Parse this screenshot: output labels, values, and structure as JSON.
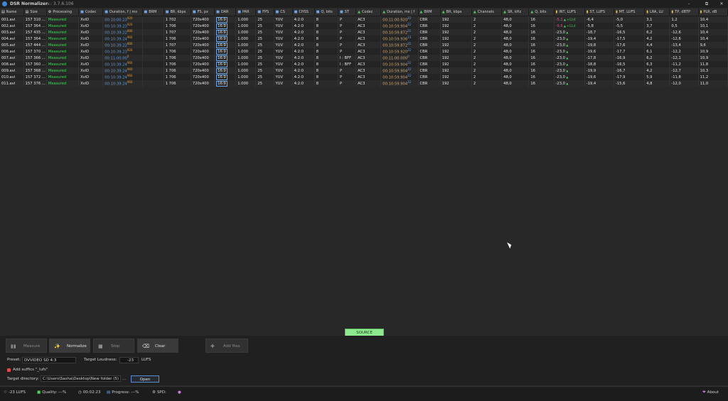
{
  "window": {
    "title": "DSR Normalizer",
    "version": "v.: 3.7.6.106",
    "controls": [
      "–",
      "⧉",
      "✕"
    ]
  },
  "colors": {
    "background": "#282828",
    "measured": "#33e04a",
    "duration_blue": "#5d9ae0",
    "duration_tan": "#c9a97a",
    "source_button": "#8ee88e",
    "int_red": "#e04a8a"
  },
  "table": {
    "columns": [
      {
        "label": "Name",
        "icon": "file-icon"
      },
      {
        "label": "Size",
        "icon": "file-icon"
      },
      {
        "label": "Processing",
        "icon": "gear-icon"
      },
      {
        "label": "Codec",
        "icon": "video-icon"
      },
      {
        "label": "Duration, f | ms",
        "icon": "video-icon"
      },
      {
        "label": "BRM",
        "icon": "video-icon"
      },
      {
        "label": "BR, kbps",
        "icon": "video-icon"
      },
      {
        "label": "FS, px",
        "icon": "video-icon"
      },
      {
        "label": "DAR",
        "icon": "video-icon"
      },
      {
        "label": "PAR",
        "icon": "video-icon"
      },
      {
        "label": "FPS",
        "icon": "video-icon"
      },
      {
        "label": "CS",
        "icon": "video-icon"
      },
      {
        "label": "CHSS",
        "icon": "video-icon"
      },
      {
        "label": "Q, bits",
        "icon": "video-icon"
      },
      {
        "label": "ST",
        "icon": "video-icon"
      },
      {
        "label": "Codec",
        "icon": "audio-icon"
      },
      {
        "label": "Duration, ms | f",
        "icon": "audio-icon"
      },
      {
        "label": "BRM",
        "icon": "audio-icon"
      },
      {
        "label": "BR, kbps",
        "icon": "audio-icon"
      },
      {
        "label": "Channels",
        "icon": "audio-icon"
      },
      {
        "label": "SR, kHz",
        "icon": "audio-icon"
      },
      {
        "label": "Q, bits",
        "icon": "audio-icon"
      },
      {
        "label": "INT, LUFS",
        "icon": "loudness-icon"
      },
      {
        "label": "ST, LUFS",
        "icon": "loudness-icon"
      },
      {
        "label": "MT, LUFS",
        "icon": "loudness-icon"
      },
      {
        "label": "LRA, LU",
        "icon": "loudness-icon"
      },
      {
        "label": "TP, dBTP",
        "icon": "loudness-icon"
      },
      {
        "label": "PLR, dB",
        "icon": "loudness-icon"
      }
    ],
    "rows": [
      {
        "name": "001.avi",
        "size": "157 310 ...",
        "processing": "Measured",
        "codec": "XviD",
        "vdur": "00:10:00.23",
        "vdur_sup": "920",
        "brm": "",
        "br": "1 702",
        "fs": "720x400",
        "dar": "16:9",
        "par": "1.000",
        "fps": "25",
        "cs": "YUV",
        "chss": "4:2:0",
        "q": "8",
        "st": "P",
        "acodec": "AC3",
        "adur": "00:11:00.920",
        "adur_sup": "22",
        "abrm": "CBR",
        "abr": "192",
        "channels": "2",
        "sr": "48,0",
        "aq": "16",
        "int": "-5,1",
        "int_sup": "+13,6",
        "int_red": true,
        "stl": "-6,4",
        "mtl": "-5,0",
        "lra": "3,1",
        "tp": "1,2",
        "plr": "10,4"
      },
      {
        "name": "002.avi",
        "size": "157 364 ...",
        "processing": "Measured",
        "codec": "XviD",
        "vdur": "00:10:39.23",
        "vdur_sup": "920",
        "brm": "",
        "br": "1 706",
        "fs": "720x400",
        "dar": "16:9",
        "par": "1.000",
        "fps": "25",
        "cs": "YUV",
        "chss": "4:2:0",
        "q": "8",
        "st": "P",
        "acodec": "AC3",
        "adur": "00:10:59.904",
        "adur_sup": "22",
        "abrm": "CBR",
        "abr": "192",
        "channels": "2",
        "sr": "48,0",
        "aq": "16",
        "int": "-9,6",
        "int_sup": "+13,4",
        "int_red": true,
        "stl": "-5,8",
        "mtl": "-5,5",
        "lra": "3,7",
        "tp": "0,5",
        "plr": "10,1"
      },
      {
        "name": "003.avi",
        "size": "157 435 ...",
        "processing": "Measured",
        "codec": "XviD",
        "vdur": "00:10:39.22",
        "vdur_sup": "880",
        "brm": "",
        "br": "1 707",
        "fs": "720x400",
        "dar": "16:9",
        "par": "1.000",
        "fps": "25",
        "cs": "YUV",
        "chss": "4:2:0",
        "q": "8",
        "st": "P",
        "acodec": "AC3",
        "adur": "00:10:59.872",
        "adur_sup": "21",
        "abrm": "CBR",
        "abr": "192",
        "channels": "2",
        "sr": "48,0",
        "aq": "16",
        "int": "-23,0",
        "int_sup": "",
        "int_red": false,
        "stl": "-18,7",
        "mtl": "-16,5",
        "lra": "6,2",
        "tp": "-12,6",
        "plr": "10,4"
      },
      {
        "name": "004.avi",
        "size": "157 364 ...",
        "processing": "Measured",
        "codec": "XviD",
        "vdur": "00:10:39.24",
        "vdur_sup": "960",
        "brm": "",
        "br": "1 706",
        "fs": "720x400",
        "dar": "16:9",
        "par": "1.000",
        "fps": "25",
        "cs": "YUV",
        "chss": "4:2:0",
        "q": "8",
        "st": "P",
        "acodec": "AC3",
        "adur": "00:10:59.936",
        "adur_sup": "23",
        "abrm": "CBR",
        "abr": "192",
        "channels": "2",
        "sr": "48,0",
        "aq": "16",
        "int": "-23,0",
        "int_sup": "",
        "int_red": false,
        "stl": "-19,4",
        "mtl": "-17,5",
        "lra": "4,2",
        "tp": "-12,6",
        "plr": "10,4"
      },
      {
        "name": "005.avi",
        "size": "157 444 ...",
        "processing": "Measured",
        "codec": "XviD",
        "vdur": "00:10:39.22",
        "vdur_sup": "880",
        "brm": "",
        "br": "1 707",
        "fs": "720x400",
        "dar": "16:9",
        "par": "1.000",
        "fps": "25",
        "cs": "YUV",
        "chss": "4:2:0",
        "q": "8",
        "st": "P",
        "acodec": "AC3",
        "adur": "00:10:59.872",
        "adur_sup": "21",
        "abrm": "CBR",
        "abr": "192",
        "channels": "2",
        "sr": "48,0",
        "aq": "16",
        "int": "-23,0",
        "int_sup": "",
        "int_red": false,
        "stl": "-19,8",
        "mtl": "-17,6",
        "lra": "4,4",
        "tp": "-13,4",
        "plr": "9,6"
      },
      {
        "name": "006.avi",
        "size": "157 370 ...",
        "processing": "Measured",
        "codec": "XviD",
        "vdur": "00:10:39.23",
        "vdur_sup": "920",
        "brm": "",
        "br": "1 706",
        "fs": "720x400",
        "dar": "16:9",
        "par": "1.000",
        "fps": "25",
        "cs": "YUV",
        "chss": "4:2:0",
        "q": "8",
        "st": "P",
        "acodec": "AC3",
        "adur": "00:10:59.920",
        "adur_sup": "22",
        "abrm": "CBR",
        "abr": "192",
        "channels": "2",
        "sr": "48,0",
        "aq": "16",
        "int": "-23,0",
        "int_sup": "",
        "int_red": false,
        "stl": "-19,6",
        "mtl": "-17,7",
        "lra": "6,1",
        "tp": "-12,2",
        "plr": "10,9"
      },
      {
        "name": "007.avi",
        "size": "157 366 ...",
        "processing": "Measured",
        "codec": "XviD",
        "vdur": "00:11:00.00",
        "vdur_sup": "0",
        "brm": "",
        "br": "1 706",
        "fs": "720x400",
        "dar": "16:9",
        "par": "1.000",
        "fps": "25",
        "cs": "YUV",
        "chss": "4:2:0",
        "q": "8",
        "st": "I : BFF",
        "acodec": "AC3",
        "adur": "00:11:00.000",
        "adur_sup": "0",
        "abrm": "CBR",
        "abr": "192",
        "channels": "2",
        "sr": "48,0",
        "aq": "16",
        "int": "-23,0",
        "int_sup": "",
        "int_red": false,
        "stl": "-17,8",
        "mtl": "-16,9",
        "lra": "6,2",
        "tp": "-12,1",
        "plr": "10,9"
      },
      {
        "name": "008.avi",
        "size": "157 360 ...",
        "processing": "Measured",
        "codec": "XviD",
        "vdur": "00:10:39.24",
        "vdur_sup": "960",
        "brm": "",
        "br": "1 706",
        "fs": "720x400",
        "dar": "16:9",
        "par": "1.000",
        "fps": "25",
        "cs": "YUV",
        "chss": "4:2:0",
        "q": "8",
        "st": "I : BFF",
        "acodec": "AC3",
        "adur": "00:10:59.904",
        "adur_sup": "22",
        "abrm": "CBR",
        "abr": "192",
        "channels": "2",
        "sr": "48,0",
        "aq": "16",
        "int": "-23,0",
        "int_sup": "",
        "int_red": false,
        "stl": "-18,8",
        "mtl": "-16,5",
        "lra": "6,3",
        "tp": "-11,2",
        "plr": "11,8"
      },
      {
        "name": "009.avi",
        "size": "157 368 ...",
        "processing": "Measured",
        "codec": "XviD",
        "vdur": "00:10:39.24",
        "vdur_sup": "960",
        "brm": "",
        "br": "1 706",
        "fs": "720x400",
        "dar": "16:9",
        "par": "1.000",
        "fps": "25",
        "cs": "YUV",
        "chss": "4:2:0",
        "q": "8",
        "st": "P",
        "acodec": "AC3",
        "adur": "00:10:59.904",
        "adur_sup": "22",
        "abrm": "CBR",
        "abr": "192",
        "channels": "2",
        "sr": "48,0",
        "aq": "16",
        "int": "-23,0",
        "int_sup": "",
        "int_red": false,
        "stl": "-19,9",
        "mtl": "-16,7",
        "lra": "4,2",
        "tp": "-12,7",
        "plr": "10,3"
      },
      {
        "name": "010.avi",
        "size": "157 372 ...",
        "processing": "Measured",
        "codec": "XviD",
        "vdur": "00:10:39.24",
        "vdur_sup": "960",
        "brm": "",
        "br": "1 706",
        "fs": "720x400",
        "dar": "16:9",
        "par": "1.000",
        "fps": "25",
        "cs": "YUV",
        "chss": "4:2:0",
        "q": "8",
        "st": "P",
        "acodec": "AC3",
        "adur": "00:10:59.904",
        "adur_sup": "22",
        "abrm": "CBR",
        "abr": "192",
        "channels": "2",
        "sr": "48,0",
        "aq": "16",
        "int": "-23,0",
        "int_sup": "",
        "int_red": false,
        "stl": "-19,6",
        "mtl": "-17,9",
        "lra": "5,9",
        "tp": "-11,8",
        "plr": "11,2"
      },
      {
        "name": "011.avi",
        "size": "157 376 ...",
        "processing": "Measured",
        "codec": "XviD",
        "vdur": "00:10:39.24",
        "vdur_sup": "960",
        "brm": "",
        "br": "1 706",
        "fs": "720x400",
        "dar": "16:9",
        "par": "1.000",
        "fps": "25",
        "cs": "YUV",
        "chss": "4:2:0",
        "q": "8",
        "st": "P",
        "acodec": "AC3",
        "adur": "00:10:59.904",
        "adur_sup": "22",
        "abrm": "CBR",
        "abr": "192",
        "channels": "2",
        "sr": "48,0",
        "aq": "16",
        "int": "-23,0",
        "int_sup": "",
        "int_red": false,
        "stl": "-19,4",
        "mtl": "-15,6",
        "lra": "4,8",
        "tp": "-12,0",
        "plr": "11,0"
      }
    ]
  },
  "source_button": "SOURCE",
  "toolbar": {
    "measure": "Measure",
    "normalize": "Normalize",
    "stop": "Stop",
    "clear": "Clear",
    "add_files": "Add files"
  },
  "settings": {
    "preset_label": "Preset:",
    "preset_value": "DVVIDEO SD 4:3",
    "target_loudness_label": "Target Loudness:",
    "target_loudness_value": "-23",
    "target_loudness_unit": "LUFS",
    "add_suffix_label": "Add suffics \"_lufs\"",
    "target_directory_label": "Target directory:",
    "target_directory_value": "C:\\Users\\Sasha\\Desktop\\New folder (5)",
    "browse_label": "...",
    "open_label": "Open"
  },
  "status": {
    "lufs": "-23 LUFS",
    "quality": "Quality: ---%",
    "time": "00:02:23",
    "progress": "Progress: ---%",
    "spd": "SPD:",
    "about": "About"
  }
}
